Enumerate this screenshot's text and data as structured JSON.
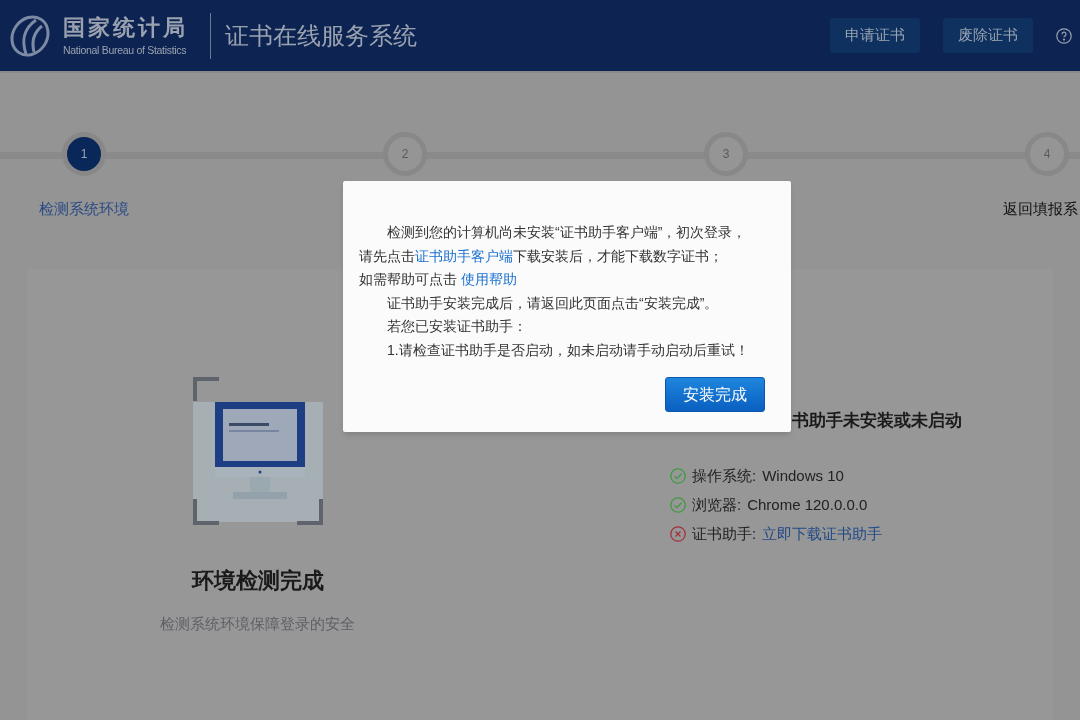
{
  "header": {
    "logo_title": "国家统计局",
    "logo_subtitle": "National Bureau of Statistics",
    "system_title": "证书在线服务系统",
    "buttons": [
      "申请证书",
      "废除证书"
    ]
  },
  "steps": [
    {
      "number": "1",
      "label": "检测系统环境",
      "selected": true
    },
    {
      "number": "2",
      "selected": false
    },
    {
      "number": "3",
      "selected": false
    },
    {
      "number": "4",
      "label": "返回填报系",
      "selected": false
    }
  ],
  "left_panel": {
    "title": "环境检测完成",
    "subtitle": "检测系统环境保障登录的安全"
  },
  "right_panel": {
    "heading": "书助手未安装或未启动",
    "checks": [
      {
        "kind": "ok",
        "label": "操作系统:",
        "value": "Windows 10",
        "link": false
      },
      {
        "kind": "ok",
        "label": "浏览器:",
        "value": "Chrome 120.0.0.0",
        "link": false
      },
      {
        "kind": "fail",
        "label": "证书助手:",
        "value": "立即下载证书助手",
        "link": true
      }
    ]
  },
  "dialog": {
    "paragraphs": [
      {
        "indent": true,
        "parts": [
          {
            "kind": "text",
            "text": "检测到您的计算机尚未安装“证书助手客户端”，初次登录，"
          },
          {
            "kind": "break"
          },
          {
            "kind": "text",
            "text": "请先点击"
          },
          {
            "kind": "link",
            "text": "证书助手客户端"
          },
          {
            "kind": "text",
            "text": "下载安装后，才能下载数字证书；"
          }
        ]
      },
      {
        "indent": false,
        "parts": [
          {
            "kind": "text",
            "text": "如需帮助可点击 "
          },
          {
            "kind": "link",
            "text": "使用帮助"
          }
        ]
      },
      {
        "indent": true,
        "parts": [
          {
            "kind": "text",
            "text": "证书助手安装完成后，请返回此页面点击“安装完成”。"
          }
        ]
      },
      {
        "indent": true,
        "parts": [
          {
            "kind": "text",
            "text": "若您已安装证书助手："
          }
        ]
      },
      {
        "indent": true,
        "parts": [
          {
            "kind": "text",
            "text": "1.请检查证书助手是否启动，如未启动请手动启动后重试！"
          }
        ]
      }
    ],
    "button": "安装完成"
  }
}
